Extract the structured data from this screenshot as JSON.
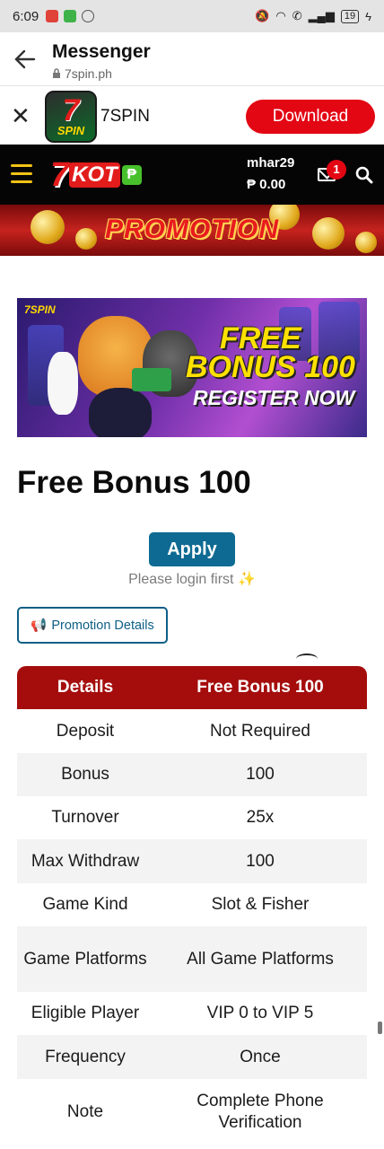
{
  "status_bar": {
    "time": "6:09",
    "battery": "19"
  },
  "messenger": {
    "title": "Messenger",
    "url": "7spin.ph"
  },
  "app_banner": {
    "logo_seven": "7",
    "logo_spin": "SPIN",
    "app_name": "7SPIN",
    "download_label": "Download"
  },
  "site_nav": {
    "logo_seven": "7",
    "logo_text": "KOT",
    "username": "mhar29",
    "balance": "₱ 0.00",
    "notification_count": "1"
  },
  "promotion_banner": {
    "label": "PROMOTION"
  },
  "hero": {
    "logo": "7SPIN",
    "line1": "FREE",
    "line2": "BONUS 100",
    "line3": "REGISTER NOW"
  },
  "page": {
    "title": "Free Bonus 100",
    "apply_label": "Apply",
    "login_hint": "Please login first ✨",
    "details_label": "Promotion Details"
  },
  "table": {
    "headers": [
      "Details",
      "Free Bonus 100"
    ],
    "rows": [
      {
        "label": "Deposit",
        "value": "Not Required"
      },
      {
        "label": "Bonus",
        "value": "100"
      },
      {
        "label": "Turnover",
        "value": "25x"
      },
      {
        "label": "Max Withdraw",
        "value": "100"
      },
      {
        "label": "Game Kind",
        "value": "Slot & Fisher"
      },
      {
        "label": "Game Platforms",
        "value": "All Game Platforms"
      },
      {
        "label": "Eligible Player",
        "value": "VIP 0 to VIP 5"
      },
      {
        "label": "Frequency",
        "value": "Once"
      },
      {
        "label": "Note",
        "value": "Complete Phone Verification"
      }
    ]
  },
  "colors": {
    "download_red": "#e30613",
    "apply_blue": "#0e6a92",
    "table_header_red": "#a50d0d",
    "nav_gold": "#f3c316"
  }
}
